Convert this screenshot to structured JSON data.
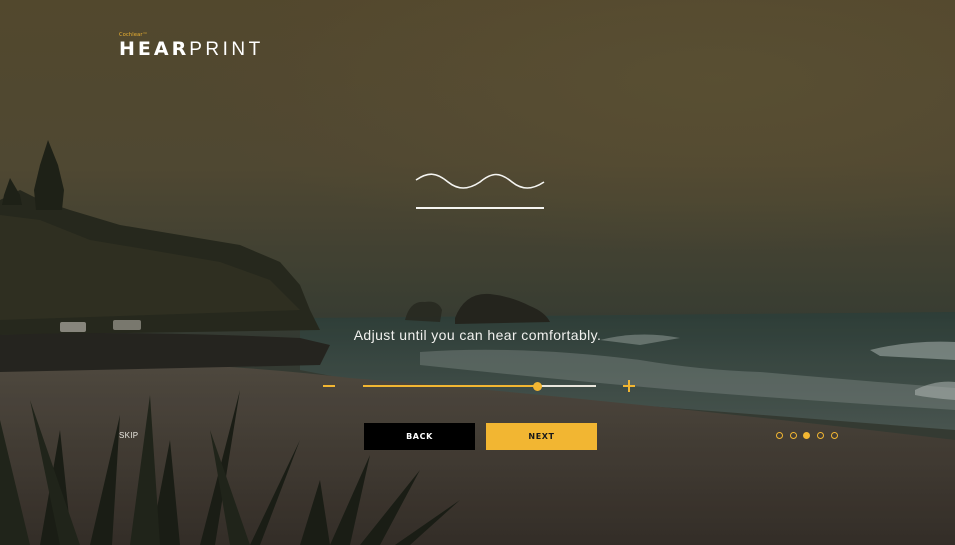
{
  "app": {
    "brand_small": "Cochlear™",
    "logo_bold": "HEAR",
    "logo_light": "PRINT"
  },
  "main": {
    "instruction": "Adjust until you can hear comfortably.",
    "wave_icon": "wave-icon",
    "volume_slider": {
      "value_fraction": 0.75
    },
    "minus_icon": "minus-icon",
    "plus_icon": "plus-icon"
  },
  "footer": {
    "skip_label": "SKIP",
    "back_label": "BACK",
    "next_label": "NEXT"
  },
  "progress": {
    "total_steps": 5,
    "current_step": 3
  },
  "colors": {
    "accent": "#f2b632",
    "button_dark": "#000000",
    "text": "#f1f1ee"
  }
}
